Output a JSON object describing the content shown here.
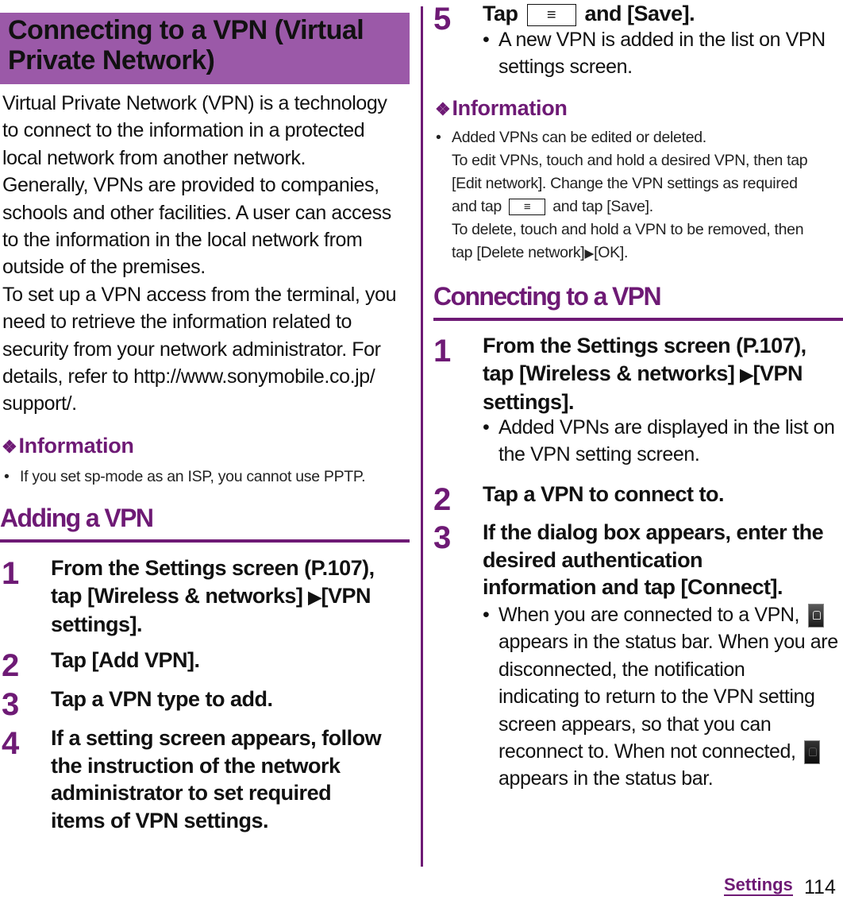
{
  "title": {
    "line1": "Connecting to a VPN (Virtual",
    "line2": "Private Network)"
  },
  "intro": {
    "lines": [
      "Virtual Private Network (VPN) is a technology",
      "to connect to the information in a protected",
      "local network from another network.",
      "Generally, VPNs are provided to companies,",
      "schools and other facilities. A user can access",
      "to the information in the local network from",
      "outside of the premises.",
      "To set up a VPN access from the terminal, you",
      "need to retrieve the information related to",
      "security from your network administrator. For",
      "details, refer to http://www.sonymobile.co.jp/",
      "support/."
    ]
  },
  "info1": {
    "heading": "Information",
    "bullet": "If you set sp-mode as an ISP, you cannot use PPTP."
  },
  "adding": {
    "heading": "Adding a VPN",
    "steps": [
      {
        "num": "1",
        "lines": [
          "From the Settings screen (P.107),",
          "tap [Wireless & networks]",
          "[VPN",
          "settings]."
        ]
      },
      {
        "num": "2",
        "text": "Tap [Add VPN]."
      },
      {
        "num": "3",
        "text": "Tap a VPN type to add."
      },
      {
        "num": "4",
        "lines": [
          "If a setting screen appears, follow",
          "the instruction of the network",
          "administrator to set required",
          "items of VPN settings."
        ]
      },
      {
        "num": "5",
        "before": "Tap",
        "after": "and [Save].",
        "note": [
          "A new VPN is added in the list on VPN",
          "settings screen."
        ]
      }
    ]
  },
  "info2": {
    "heading": "Information",
    "lines": [
      "Added VPNs can be edited or deleted.",
      "To edit VPNs, touch and hold a desired VPN, then tap",
      "[Edit network]. Change the VPN settings as required",
      "and tap",
      "and tap [Save].",
      "To delete, touch and hold a VPN to be removed, then",
      "tap [Delete network]",
      "[OK]."
    ]
  },
  "connecting": {
    "heading": "Connecting to a VPN",
    "steps": [
      {
        "num": "1",
        "lines": [
          "From the Settings screen (P.107),",
          "tap [Wireless & networks]",
          "[VPN",
          "settings]."
        ],
        "note": [
          "Added VPNs are displayed in the list on",
          "the VPN setting screen."
        ]
      },
      {
        "num": "2",
        "text": "Tap a VPN to connect to."
      },
      {
        "num": "3",
        "lines": [
          "If the dialog box appears, enter the",
          "desired authentication",
          "information and tap [Connect]."
        ],
        "note": [
          "When you are connected to a VPN,",
          "appears in the status bar. When you are",
          "disconnected, the notification",
          "indicating to return to the VPN setting",
          "screen appears, so that you can",
          "reconnect to. When not connected,",
          "appears in the status bar."
        ]
      }
    ]
  },
  "glyphs": {
    "bullet": "•",
    "diamond": "❖",
    "arrow": "▶",
    "menu_key": "≡"
  },
  "icons": {
    "vpn_connected": "vpn-connected-status-icon",
    "vpn_disconnected": "vpn-disconnected-status-icon",
    "menu_key": "menu-key-icon"
  },
  "colors": {
    "accent": "#6e1a75",
    "title_bg": "#9b59a8"
  },
  "footer": {
    "section": "Settings",
    "page": "114"
  }
}
